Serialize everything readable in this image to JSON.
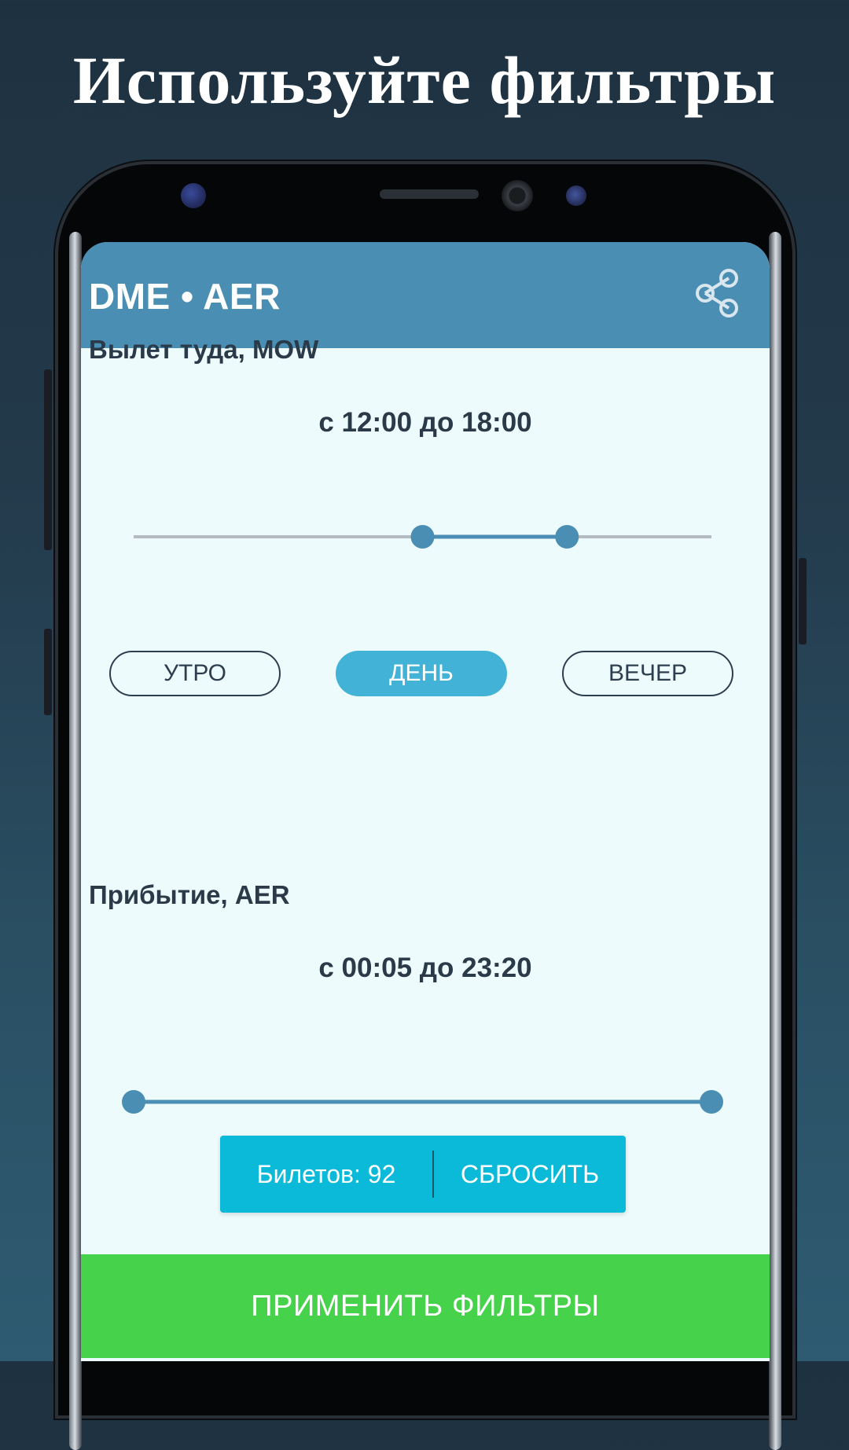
{
  "promo": {
    "headline": "Используйте фильтры"
  },
  "app_bar": {
    "title": "DME • AER",
    "share_icon": "share-icon"
  },
  "departure": {
    "label": "Вылет туда, MOW",
    "range_text": "с 12:00 до 18:00",
    "slider": {
      "min": "00:00",
      "max": "24:00",
      "low": "12:00",
      "high": "18:00",
      "low_fraction": 0.5,
      "high_fraction": 0.75
    },
    "chips": [
      {
        "label": "УТРО",
        "active": false
      },
      {
        "label": "ДЕНЬ",
        "active": true
      },
      {
        "label": "ВЕЧЕР",
        "active": false
      }
    ]
  },
  "arrival": {
    "label": "Прибытие, AER",
    "range_text": "с 00:05 до 23:20",
    "slider": {
      "low_fraction": 0.0,
      "high_fraction": 1.0
    }
  },
  "snackbar": {
    "count_text": "Билетов: 92",
    "action_label": "СБРОСИТЬ"
  },
  "apply_button": {
    "label": "ПРИМЕНИТЬ ФИЛЬТРЫ"
  },
  "colors": {
    "app_bar": "#4a8fb3",
    "slider_active": "#4a8fb3",
    "slider_track": "#b4bcc1",
    "chip_active": "#42b3d6",
    "snackbar": "#0bbad8",
    "apply_button": "#47d24b",
    "screen_bg": "#eefbfd"
  }
}
